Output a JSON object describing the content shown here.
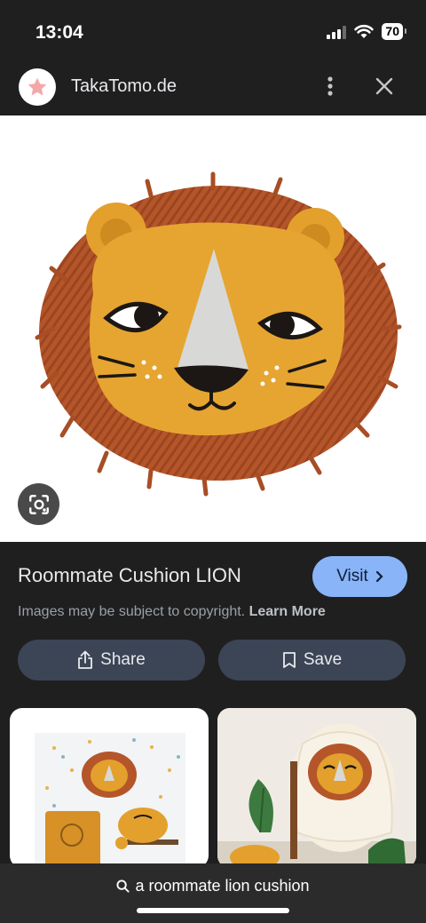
{
  "status": {
    "time": "13:04",
    "battery": "70"
  },
  "header": {
    "site_name": "TakaTomo.de",
    "favicon_icon": "star-icon"
  },
  "hero": {
    "alt": "Roommate Cushion LION product image",
    "lens_icon": "google-lens-icon"
  },
  "info": {
    "title": "Roommate Cushion LION",
    "visit_label": "Visit",
    "copyright_text": "Images may be subject to copyright.",
    "learn_more": "Learn More",
    "share_label": "Share",
    "save_label": "Save"
  },
  "related": [
    {
      "alt": "lion cushion on wall with storage basket"
    },
    {
      "alt": "lion cushion on fur chair"
    }
  ],
  "bottom": {
    "query": "a roommate lion cushion"
  },
  "colors": {
    "accent": "#8ab4f8",
    "pill": "#3c4556",
    "background": "#1f1f1f"
  }
}
